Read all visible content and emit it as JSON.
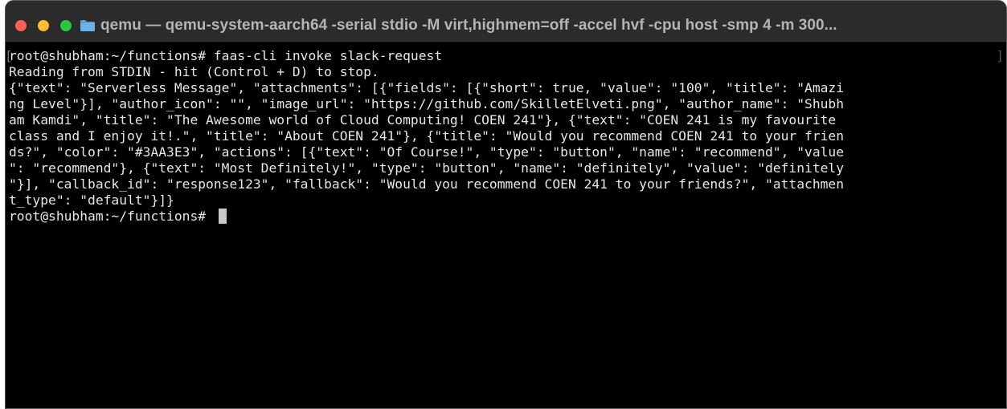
{
  "window": {
    "title": "qemu — qemu-system-aarch64 -serial stdio -M virt,highmem=off -accel hvf -cpu host -smp 4 -m 300..."
  },
  "colors": {
    "close": "#fe5f57",
    "minimize": "#febc2e",
    "maximize": "#28c840",
    "folder": "#5aa0d8"
  },
  "terminal": {
    "lines": [
      "root@shubham:~/functions# faas-cli invoke slack-request",
      "Reading from STDIN - hit (Control + D) to stop.",
      "{\"text\": \"Serverless Message\", \"attachments\": [{\"fields\": [{\"short\": true, \"value\": \"100\", \"title\": \"Amazi",
      "ng Level\"}], \"author_icon\": \"\", \"image_url\": \"https://github.com/SkilletElveti.png\", \"author_name\": \"Shubh",
      "am Kamdi\", \"title\": \"The Awesome world of Cloud Computing! COEN 241\"}, {\"text\": \"COEN 241 is my favourite",
      "class and I enjoy it!.\", \"title\": \"About COEN 241\"}, {\"title\": \"Would you recommend COEN 241 to your frien",
      "ds?\", \"color\": \"#3AA3E3\", \"actions\": [{\"text\": \"Of Course!\", \"type\": \"button\", \"name\": \"recommend\", \"value",
      "\": \"recommend\"}, {\"text\": \"Most Definitely!\", \"type\": \"button\", \"name\": \"definitely\", \"value\": \"definitely",
      "\"}], \"callback_id\": \"response123\", \"fallback\": \"Would you recommend COEN 241 to your friends?\", \"attachmen",
      "t_type\": \"default\"}]}"
    ],
    "prompt": "root@shubham:~/functions# "
  }
}
